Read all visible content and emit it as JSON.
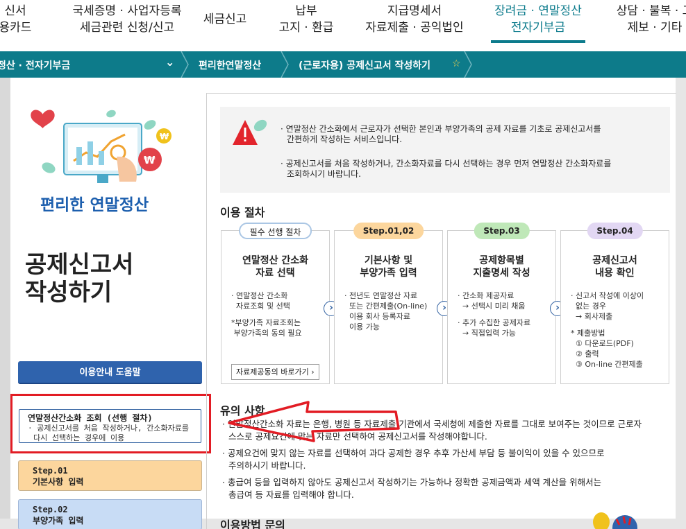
{
  "top_menu": [
    {
      "l1": "신서",
      "l2": "용카드"
    },
    {
      "l1": "국세증명 · 사업자등록",
      "l2": "세금관련 신청/신고"
    },
    {
      "l1": "세금신고",
      "l2": ""
    },
    {
      "l1": "납부",
      "l2": "고지 · 환급"
    },
    {
      "l1": "지급명세서",
      "l2": "자료제출 · 공익법인"
    },
    {
      "l1": "장려금 · 연말정산",
      "l2": "전자기부금"
    },
    {
      "l1": "상담 · 불복 · 고",
      "l2": "제보 · 기타"
    }
  ],
  "breadcrumb": {
    "item1": "정산 · 전자기부금",
    "item2": "편리한연말정산",
    "item3": "(근로자용) 공제신고서 작성하기",
    "chevron": "⌄",
    "star": "☆"
  },
  "sidebar": {
    "brand": "편리한 연말정산",
    "title_l1": "공제신고서",
    "title_l2": "작성하기",
    "help_button": "이용안내 도움말",
    "pre_step": {
      "title": "연말정산간소화 조회 (선행 절차)",
      "desc1": "· 공제신고서를 처음 작성하거나, 간소화자료를",
      "desc2": "다시 선택하는 경우에 이용"
    },
    "step1": {
      "label": "Step.01",
      "name": "기본사항 입력"
    },
    "step2": {
      "label": "Step.02",
      "name": "부양가족 입력"
    }
  },
  "notice": {
    "line1": "· 연말정산 간소화에서 근로자가 선택한 본인과 부양가족의 공제 자료를 기초로 공제신고서를",
    "line2": "간편하게 작성하는 서비스입니다.",
    "line3": "· 공제신고서를 처음 작성하거나, 간소화자료를 다시 선택하는 경우 먼저 연말정산 간소화자료를",
    "line4": "조회하시기 바랍니다."
  },
  "procedure": {
    "heading": "이용 절차",
    "cards": [
      {
        "badge": "필수 선행 절차",
        "title1": "연말정산 간소화",
        "title2": "자료 선택",
        "body": [
          "· 연말정산 간소화",
          "  자료조회 및 선택",
          "",
          "*부양가족 자료조회는",
          " 부양가족의 동의 필요"
        ],
        "link": "자료제공동의 바로가기 ›"
      },
      {
        "badge": "Step.01,02",
        "title1": "기본사항 및",
        "title2": "부양가족 입력",
        "body": [
          "· 전년도 연말정산 자료",
          "  또는 간편제출(On-line)",
          "  이용 회사 등록자료",
          "  이용 가능"
        ]
      },
      {
        "badge": "Step.03",
        "title1": "공제항목별",
        "title2": "지출명세 작성",
        "body": [
          "· 간소화 제공자료",
          "  → 선택시 미리 채움",
          "",
          "· 추가 수집한 공제자료",
          "  → 직접입력 가능"
        ]
      },
      {
        "badge": "Step.04",
        "title1": "공제신고서",
        "title2": "내용 확인",
        "body": [
          "· 신고서 작성에 이상이",
          "  없는 경우",
          "  → 회사제출",
          "",
          "* 제출방법",
          "  ① 다운로드(PDF)",
          "  ② 출력",
          "  ③ On-line 간편제출"
        ]
      }
    ],
    "arrow_glyph": "›"
  },
  "notes": {
    "heading": "유의 사항",
    "n1a": "· 연말정산간소화 자료는 은행, 병원 등 자료제출 기관에서 국세청에 제출한 자료를 그대로 보여주는 것이므로 근로자",
    "n1b": "스스로 공제요건에 맞는 자료만 선택하여 공제신고서를 작성해야합니다.",
    "n2a": "· 공제요건에 맞지 않는 자료를 선택하여 과다 공제한 경우 추후 가산세 부담 등 불이익이 있을 수 있으므로",
    "n2b": "주의하시기 바랍니다.",
    "n3a": "· 총급여 등을 입력하지 않아도 공제신고서 작성하기는 가능하나 정확한 공제금액과 세액 계산을 위해서는",
    "n3b": "총급여 등 자료를 입력해야 합니다."
  },
  "inquiry": {
    "heading": "이용방법 문의"
  },
  "colors": {
    "teal": "#0d7b8a",
    "blue": "#2f63ad",
    "red": "#e21c24"
  }
}
